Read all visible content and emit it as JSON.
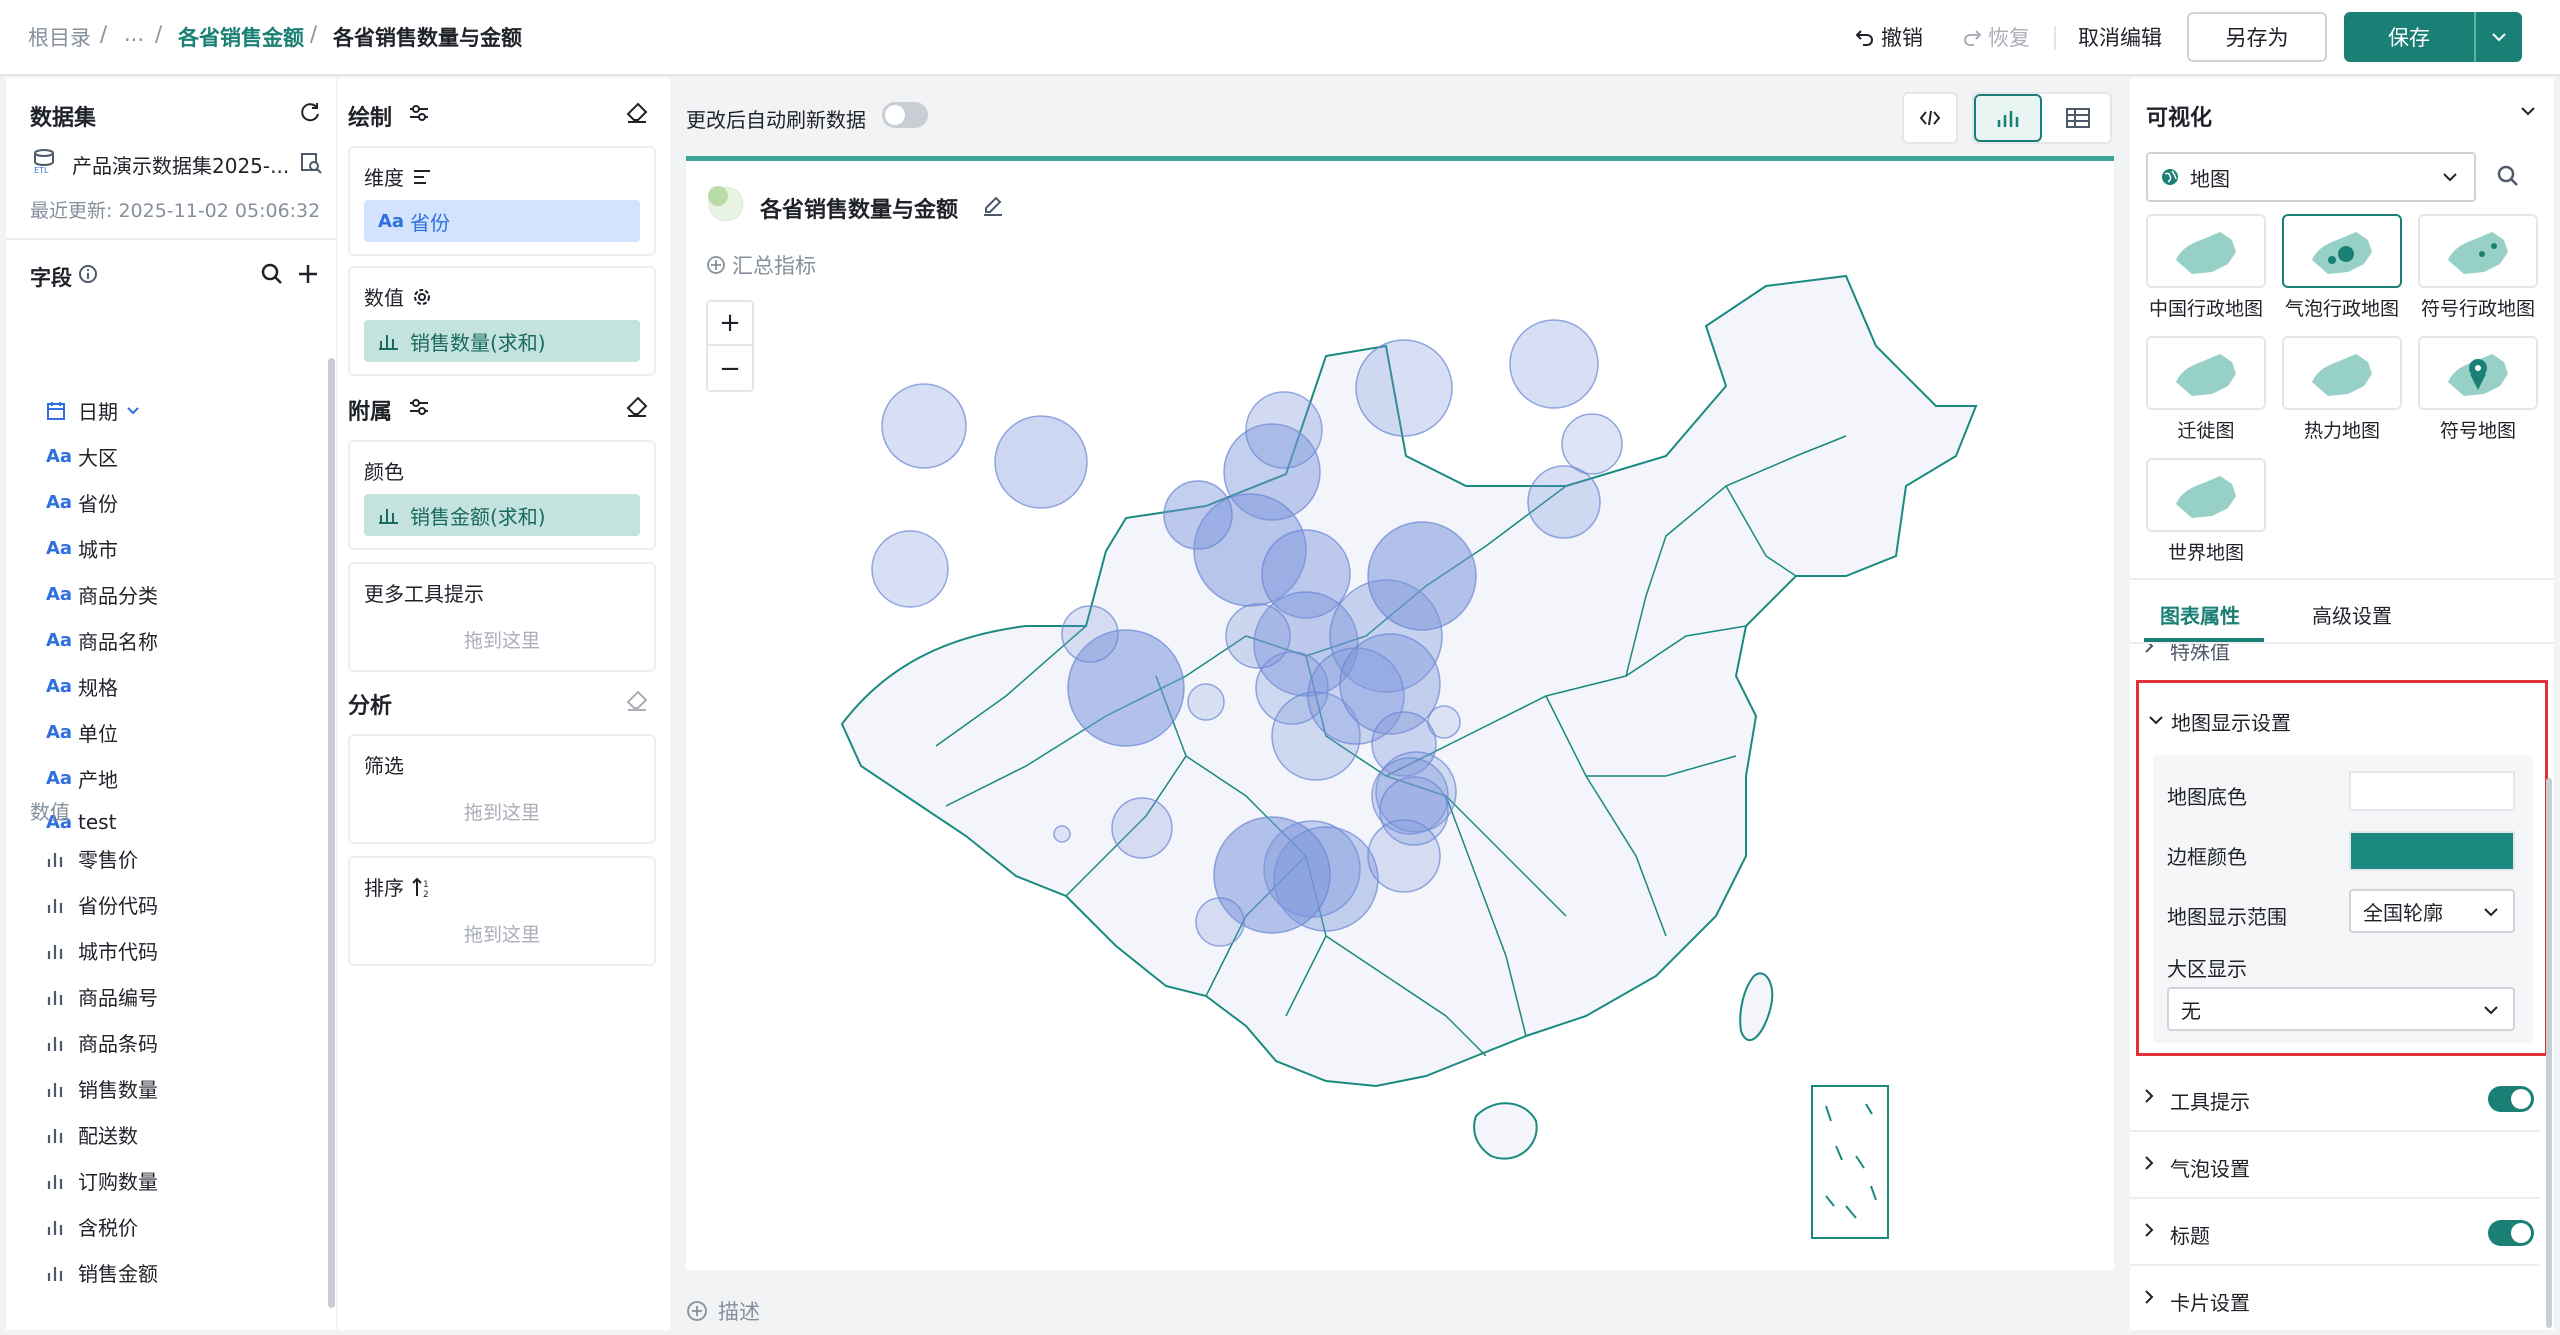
{
  "breadcrumb": {
    "root": "根目录",
    "sep": "/",
    "ellipsis": "...",
    "parent": "各省销售金额",
    "current": "各省销售数量与金额"
  },
  "toolbar": {
    "undo": "撤销",
    "redo": "恢复",
    "cancel_edit": "取消编辑",
    "save_as": "另存为",
    "save": "保存"
  },
  "dataset": {
    "title": "数据集",
    "name": "产品演示数据集2025-...",
    "last_update": "最近更新: 2025-11-02 05:06:32",
    "fields_title": "字段",
    "dimension_fields": [
      {
        "type": "date",
        "label": "日期"
      },
      {
        "type": "text",
        "label": "大区"
      },
      {
        "type": "text",
        "label": "省份"
      },
      {
        "type": "text",
        "label": "城市"
      },
      {
        "type": "text",
        "label": "商品分类"
      },
      {
        "type": "text",
        "label": "商品名称"
      },
      {
        "type": "text",
        "label": "规格"
      },
      {
        "type": "text",
        "label": "单位"
      },
      {
        "type": "text",
        "label": "产地"
      },
      {
        "type": "text",
        "label": "test"
      }
    ],
    "numeric_title": "数值",
    "numeric_fields": [
      "零售价",
      "省份代码",
      "城市代码",
      "商品编号",
      "商品条码",
      "销售数量",
      "配送数",
      "订购数量",
      "含税价",
      "销售金额"
    ],
    "text_type_glyph": "Aa"
  },
  "build": {
    "draw_title": "绘制",
    "dimension_label": "维度",
    "dimension_chip": "省份",
    "value_label": "数值",
    "value_chip": "销售数量(求和)",
    "attach_title": "附属",
    "color_label": "颜色",
    "color_chip": "销售金额(求和)",
    "tooltip_label": "更多工具提示",
    "drop_here": "拖到这里",
    "analysis_title": "分析",
    "filter_label": "筛选",
    "sort_label": "排序"
  },
  "canvas": {
    "auto_refresh_label": "更改后自动刷新数据",
    "chart_title": "各省销售数量与金额",
    "summary_metric": "汇总指标",
    "zoom_in": "+",
    "zoom_out": "−",
    "describe": "描述",
    "accent_color": "#3aa597"
  },
  "visualization": {
    "title": "可视化",
    "selected_type": "地图",
    "map_types": [
      "中国行政地图",
      "气泡行政地图",
      "符号行政地图",
      "迁徙图",
      "热力地图",
      "符号地图",
      "世界地图"
    ],
    "selected_index": 1,
    "tabs": [
      "图表属性",
      "高级设置"
    ],
    "partial_section": "特殊值",
    "map_display": {
      "title": "地图显示设置",
      "base_color_label": "地图底色",
      "border_color_label": "边框颜色",
      "border_color": "#1a8a80",
      "range_label": "地图显示范围",
      "range_value": "全国轮廓",
      "region_label": "大区显示",
      "region_value": "无"
    },
    "sections": [
      {
        "label": "工具提示",
        "toggle": true
      },
      {
        "label": "气泡设置",
        "toggle": false
      },
      {
        "label": "标题",
        "toggle": true
      },
      {
        "label": "卡片设置",
        "toggle": false
      }
    ]
  },
  "colors": {
    "brand": "#1a7f74",
    "bubble": "#7b95db",
    "highlight_border": "#e0303a"
  }
}
